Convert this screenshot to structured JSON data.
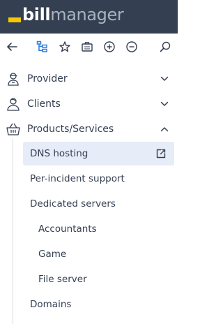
{
  "app": {
    "logo_bill": "bill",
    "logo_manager": "manager",
    "brand_color": "#f6c800",
    "header_bg": "#343f52"
  },
  "toolbar": {
    "icons": [
      "back-arrow-icon",
      "tree-icon",
      "star-icon",
      "briefcase-icon",
      "plus-circle-icon",
      "minus-circle-icon",
      "search-icon"
    ]
  },
  "menu": {
    "groups": [
      {
        "label": "Provider",
        "icon": "provider-icon",
        "expanded": false
      },
      {
        "label": "Clients",
        "icon": "clients-icon",
        "expanded": false
      },
      {
        "label": "Products/Services",
        "icon": "basket-icon",
        "expanded": true
      }
    ],
    "items": [
      {
        "label": "DNS hosting",
        "active": true,
        "external": true
      },
      {
        "label": "Per-incident support"
      },
      {
        "label": "Dedicated servers"
      },
      {
        "label": "Accountants"
      },
      {
        "label": "Game"
      },
      {
        "label": "File server"
      },
      {
        "label": "Domains"
      }
    ],
    "active_bg": "#e6edf8"
  }
}
